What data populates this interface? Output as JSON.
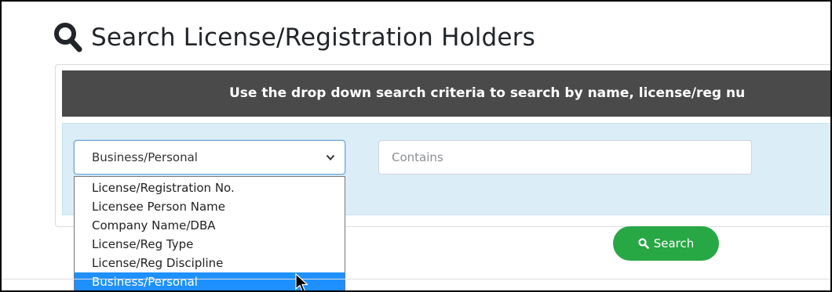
{
  "page": {
    "title": "Search License/Registration Holders",
    "title_icon": "search-icon"
  },
  "info_bar": {
    "text": "Use the drop down search criteria to search by name, license/reg nu"
  },
  "search_form": {
    "criteria_select": {
      "selected": "Business/Personal",
      "options": [
        "License/Registration No.",
        "Licensee Person Name",
        "Company Name/DBA",
        "License/Reg Type",
        "License/Reg Discipline",
        "Business/Personal"
      ],
      "highlighted_index": 5,
      "expanded": true
    },
    "query_input": {
      "value": "",
      "placeholder": "Contains"
    },
    "search_button": {
      "label": "Search",
      "icon": "search-icon"
    }
  },
  "colors": {
    "info_bar_bg": "#4a4a4a",
    "panel_bg": "#dbeef8",
    "button_green": "#28a745",
    "highlight_blue": "#1e90ff"
  }
}
